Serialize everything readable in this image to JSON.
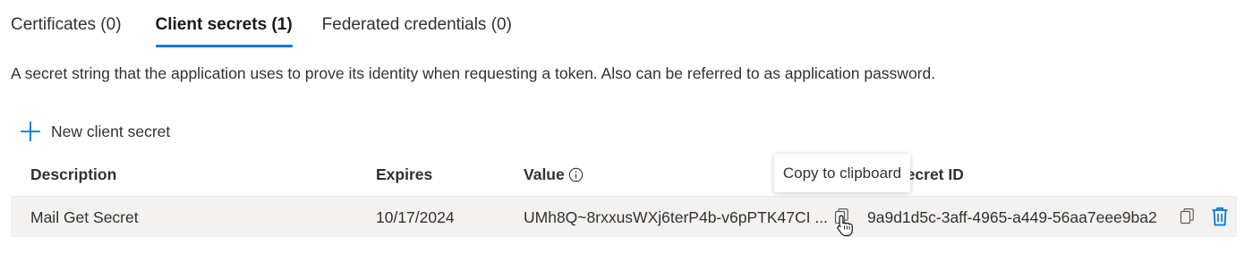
{
  "tabs": [
    {
      "label": "Certificates (0)",
      "active": false
    },
    {
      "label": "Client secrets (1)",
      "active": true
    },
    {
      "label": "Federated credentials (0)",
      "active": false
    }
  ],
  "description": "A secret string that the application uses to prove its identity when requesting a token. Also can be referred to as application password.",
  "toolbar": {
    "new_secret_label": "New client secret",
    "new_secret_icon": "plus-icon"
  },
  "table": {
    "columns": [
      "Description",
      "Expires",
      "Value",
      "Secret ID"
    ],
    "value_info_icon": "info-icon",
    "rows": [
      {
        "description": "Mail Get Secret",
        "expires": "10/17/2024",
        "value": "UMh8Q~8rxxusWXj6terP4b-v6pPTK47CI ...",
        "secret_id": "9a9d1d5c-3aff-4965-a449-56aa7eee9ba2"
      }
    ]
  },
  "tooltip": {
    "text": "Copy to clipboard"
  },
  "colors": {
    "accent": "#0078d4",
    "row_background": "#f3f2f1",
    "text": "#323130"
  }
}
